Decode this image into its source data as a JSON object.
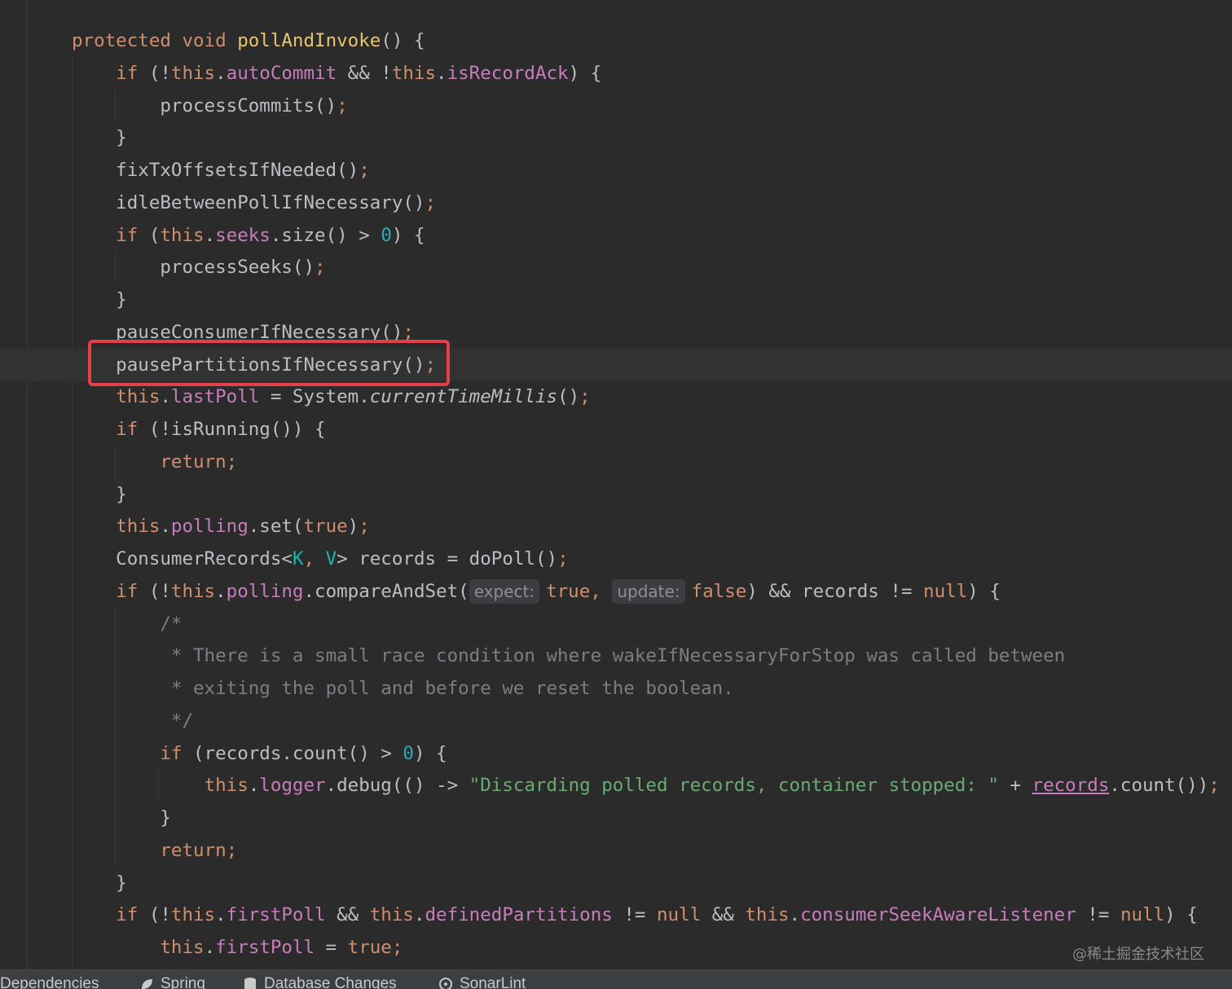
{
  "editor": {
    "language": "java",
    "highlighted_line": 11,
    "lines": [
      [
        [
          "kw",
          "protected "
        ],
        [
          "kw",
          "void "
        ],
        [
          "decl",
          "pollAndInvoke"
        ],
        [
          "",
          "() {"
        ]
      ],
      [
        [
          "",
          "    "
        ],
        [
          "kw",
          "if "
        ],
        [
          "",
          "(!"
        ],
        [
          "kw",
          "this"
        ],
        [
          "",
          "."
        ],
        [
          "field",
          "autoCommit"
        ],
        [
          "",
          " && !"
        ],
        [
          "kw",
          "this"
        ],
        [
          "",
          "."
        ],
        [
          "field",
          "isRecordAck"
        ],
        [
          "",
          ") {"
        ]
      ],
      [
        [
          "",
          "        processCommits()"
        ],
        [
          "semi",
          ";"
        ]
      ],
      [
        [
          "",
          "    }"
        ]
      ],
      [
        [
          "",
          "    fixTxOffsetsIfNeeded()"
        ],
        [
          "semi",
          ";"
        ]
      ],
      [
        [
          "",
          "    idleBetweenPollIfNecessary()"
        ],
        [
          "semi",
          ";"
        ]
      ],
      [
        [
          "",
          "    "
        ],
        [
          "kw",
          "if "
        ],
        [
          "",
          "("
        ],
        [
          "kw",
          "this"
        ],
        [
          "",
          "."
        ],
        [
          "field",
          "seeks"
        ],
        [
          "",
          ".size() > "
        ],
        [
          "num",
          "0"
        ],
        [
          "",
          ") {"
        ]
      ],
      [
        [
          "",
          "        processSeeks()"
        ],
        [
          "semi",
          ";"
        ]
      ],
      [
        [
          "",
          "    }"
        ]
      ],
      [
        [
          "",
          "    pauseConsumerIfNecessary()"
        ],
        [
          "semi",
          ";"
        ]
      ],
      [
        [
          "",
          "    pausePartitionsIfNecessary()"
        ],
        [
          "semi",
          ";"
        ]
      ],
      [
        [
          "",
          "    "
        ],
        [
          "kw",
          "this"
        ],
        [
          "",
          "."
        ],
        [
          "field",
          "lastPoll"
        ],
        [
          "",
          " = System."
        ],
        [
          "ital",
          "currentTimeMillis"
        ],
        [
          "",
          "()"
        ],
        [
          "semi",
          ";"
        ]
      ],
      [
        [
          "",
          "    "
        ],
        [
          "kw",
          "if "
        ],
        [
          "",
          "(!isRunning()) {"
        ]
      ],
      [
        [
          "",
          "        "
        ],
        [
          "kw",
          "return"
        ],
        [
          "semi",
          ";"
        ]
      ],
      [
        [
          "",
          "    }"
        ]
      ],
      [
        [
          "",
          "    "
        ],
        [
          "kw",
          "this"
        ],
        [
          "",
          "."
        ],
        [
          "field",
          "polling"
        ],
        [
          "",
          ".set("
        ],
        [
          "kw",
          "true"
        ],
        [
          "",
          ")"
        ],
        [
          "semi",
          ";"
        ]
      ],
      [
        [
          "",
          "    ConsumerRecords<"
        ],
        [
          "gen",
          "K"
        ],
        [
          "semi",
          ", "
        ],
        [
          "gen",
          "V"
        ],
        [
          "",
          "> records = doPoll()"
        ],
        [
          "semi",
          ";"
        ]
      ],
      [
        [
          "",
          "    "
        ],
        [
          "kw",
          "if "
        ],
        [
          "",
          "(!"
        ],
        [
          "kw",
          "this"
        ],
        [
          "",
          "."
        ],
        [
          "field",
          "polling"
        ],
        [
          "",
          ".compareAndSet("
        ],
        [
          "hint",
          "expect:"
        ],
        [
          "kw",
          "true"
        ],
        [
          "semi",
          ", "
        ],
        [
          "hint",
          "update:"
        ],
        [
          "kw",
          "false"
        ],
        [
          "",
          ") && records != "
        ],
        [
          "kw",
          "null"
        ],
        [
          "",
          ") {"
        ]
      ],
      [
        [
          "",
          "        "
        ],
        [
          "cmt",
          "/*"
        ]
      ],
      [
        [
          "",
          "        "
        ],
        [
          "cmt",
          " * There is a small race condition where wakeIfNecessaryForStop was called between"
        ]
      ],
      [
        [
          "",
          "        "
        ],
        [
          "cmt",
          " * exiting the poll and before we reset the boolean."
        ]
      ],
      [
        [
          "",
          "        "
        ],
        [
          "cmt",
          " */"
        ]
      ],
      [
        [
          "",
          "        "
        ],
        [
          "kw",
          "if "
        ],
        [
          "",
          "(records.count() > "
        ],
        [
          "num",
          "0"
        ],
        [
          "",
          ") {"
        ]
      ],
      [
        [
          "",
          "            "
        ],
        [
          "kw",
          "this"
        ],
        [
          "",
          "."
        ],
        [
          "field",
          "logger"
        ],
        [
          "",
          ".debug(() -> "
        ],
        [
          "str",
          "\"Discarding polled records, container stopped: \""
        ],
        [
          "",
          " + "
        ],
        [
          "uline",
          "records"
        ],
        [
          "",
          ".count())"
        ],
        [
          "semi",
          ";"
        ]
      ],
      [
        [
          "",
          "        }"
        ]
      ],
      [
        [
          "",
          "        "
        ],
        [
          "kw",
          "return"
        ],
        [
          "semi",
          ";"
        ]
      ],
      [
        [
          "",
          "    }"
        ]
      ],
      [
        [
          "",
          "    "
        ],
        [
          "kw",
          "if "
        ],
        [
          "",
          "(!"
        ],
        [
          "kw",
          "this"
        ],
        [
          "",
          "."
        ],
        [
          "field",
          "firstPoll"
        ],
        [
          "",
          " && "
        ],
        [
          "kw",
          "this"
        ],
        [
          "",
          "."
        ],
        [
          "field",
          "definedPartitions"
        ],
        [
          "",
          " != "
        ],
        [
          "kw",
          "null"
        ],
        [
          "",
          " && "
        ],
        [
          "kw",
          "this"
        ],
        [
          "",
          "."
        ],
        [
          "field",
          "consumerSeekAwareListener"
        ],
        [
          "",
          " != "
        ],
        [
          "kw",
          "null"
        ],
        [
          "",
          ") {"
        ]
      ],
      [
        [
          "",
          "        "
        ],
        [
          "kw",
          "this"
        ],
        [
          "",
          "."
        ],
        [
          "field",
          "firstPoll"
        ],
        [
          "",
          " = "
        ],
        [
          "kw",
          "true"
        ],
        [
          "semi",
          ";"
        ]
      ]
    ]
  },
  "watermark": "@稀土掘金技术社区",
  "tool_tabs": [
    {
      "label": "Dependencies",
      "icon": "dependencies-icon"
    },
    {
      "label": "Spring",
      "icon": "spring-leaf-icon"
    },
    {
      "label": "Database Changes",
      "icon": "database-icon"
    },
    {
      "label": "SonarLint",
      "icon": "sonarlint-icon"
    }
  ],
  "colors": {
    "background": "#2b2b2b",
    "keyword": "#cf8e6d",
    "field": "#c77dbb",
    "number": "#2aacb8",
    "string": "#6aab73",
    "comment": "#7a7e85",
    "highlight_box": "#e5404a"
  }
}
